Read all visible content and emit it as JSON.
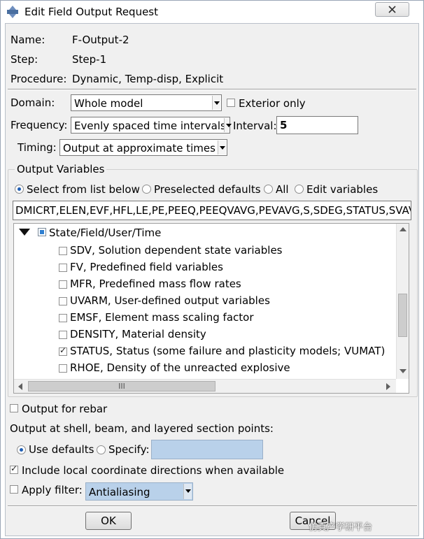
{
  "window": {
    "title": "Edit Field Output Request"
  },
  "info": {
    "name_label": "Name:",
    "name_value": "F-Output-2",
    "step_label": "Step:",
    "step_value": "Step-1",
    "procedure_label": "Procedure:",
    "procedure_value": "Dynamic, Temp-disp, Explicit"
  },
  "domain": {
    "label": "Domain:",
    "value": "Whole model",
    "exterior_only_label": "Exterior only",
    "exterior_only_checked": false
  },
  "frequency": {
    "label": "Frequency:",
    "value": "Evenly spaced time intervals",
    "interval_label": "Interval:",
    "interval_value": "5"
  },
  "timing": {
    "label": "Timing:",
    "value": "Output at approximate times"
  },
  "output_variables": {
    "group_label": "Output Variables",
    "radios": [
      {
        "label": "Select from list below",
        "selected": true
      },
      {
        "label": "Preselected defaults",
        "selected": false
      },
      {
        "label": "All",
        "selected": false
      },
      {
        "label": "Edit variables",
        "selected": false
      }
    ],
    "variables_text": "DMICRT,ELEN,EVF,HFL,LE,PE,PEEQ,PEEQVAVG,PEVAVG,S,SDEG,STATUS,SVAVG",
    "tree_group_label": "State/Field/User/Time",
    "tree_items": [
      {
        "label": "SDV, Solution dependent state variables",
        "checked": false
      },
      {
        "label": "FV, Predefined field variables",
        "checked": false
      },
      {
        "label": "MFR, Predefined mass flow rates",
        "checked": false
      },
      {
        "label": "UVARM, User-defined output variables",
        "checked": false
      },
      {
        "label": "EMSF, Element mass scaling factor",
        "checked": false
      },
      {
        "label": "DENSITY, Material density",
        "checked": false
      },
      {
        "label": "STATUS, Status (some failure and plasticity models; VUMAT)",
        "checked": true
      },
      {
        "label": "RHOE, Density of the unreacted explosive",
        "checked": false
      }
    ],
    "hscroll_grip": "III"
  },
  "rebar": {
    "label": "Output for rebar",
    "checked": false
  },
  "section_points": {
    "label": "Output at shell, beam, and layered section points:",
    "use_defaults_label": "Use defaults",
    "use_defaults_selected": true,
    "specify_label": "Specify:",
    "specify_value": ""
  },
  "local_coords": {
    "label": "Include local coordinate directions when available",
    "checked": true
  },
  "filter": {
    "label": "Apply filter:",
    "checked": false,
    "value": "Antialiasing"
  },
  "buttons": {
    "ok": "OK",
    "cancel": "Cancel"
  },
  "watermark": "仿真产学研平台",
  "colors": {
    "disabled_field": "#b9d1ea",
    "accent_blue": "#1f5fb5"
  }
}
